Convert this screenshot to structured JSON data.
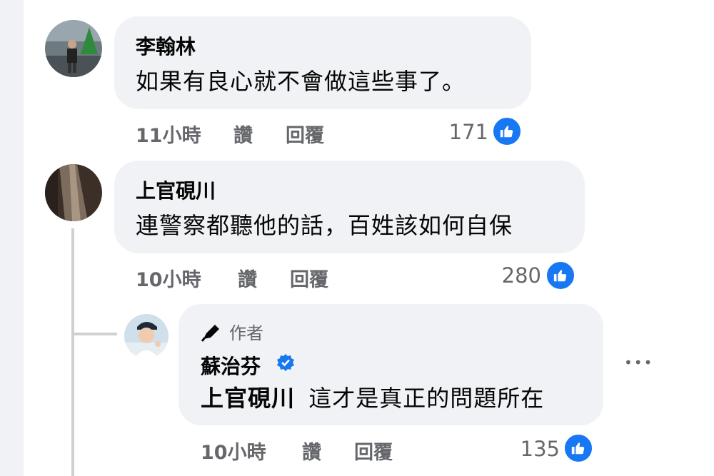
{
  "comments": [
    {
      "author": "李翰林",
      "text": "如果有良心就不會做這些事了。",
      "time": "11小時",
      "like_label": "讚",
      "reply_label": "回覆",
      "like_count": "171"
    },
    {
      "author": "上官硯川",
      "text": "連警察都聽他的話，百姓該如何自保",
      "time": "10小時",
      "like_label": "讚",
      "reply_label": "回覆",
      "like_count": "280"
    }
  ],
  "reply": {
    "badge": "作者",
    "author": "蘇治芬",
    "mention": "上官硯川",
    "text": "這才是真正的問題所在",
    "time": "10小時",
    "like_label": "讚",
    "reply_label": "回覆",
    "like_count": "135",
    "more": "•••"
  },
  "colors": {
    "bubble": "#f0f2f5",
    "like_blue": "#1877f2",
    "meta_gray": "#65676b",
    "thread_line": "#ced0d4"
  },
  "icons": [
    "thumbs-up-icon",
    "pen-icon",
    "verified-badge-icon",
    "more-options-icon"
  ]
}
